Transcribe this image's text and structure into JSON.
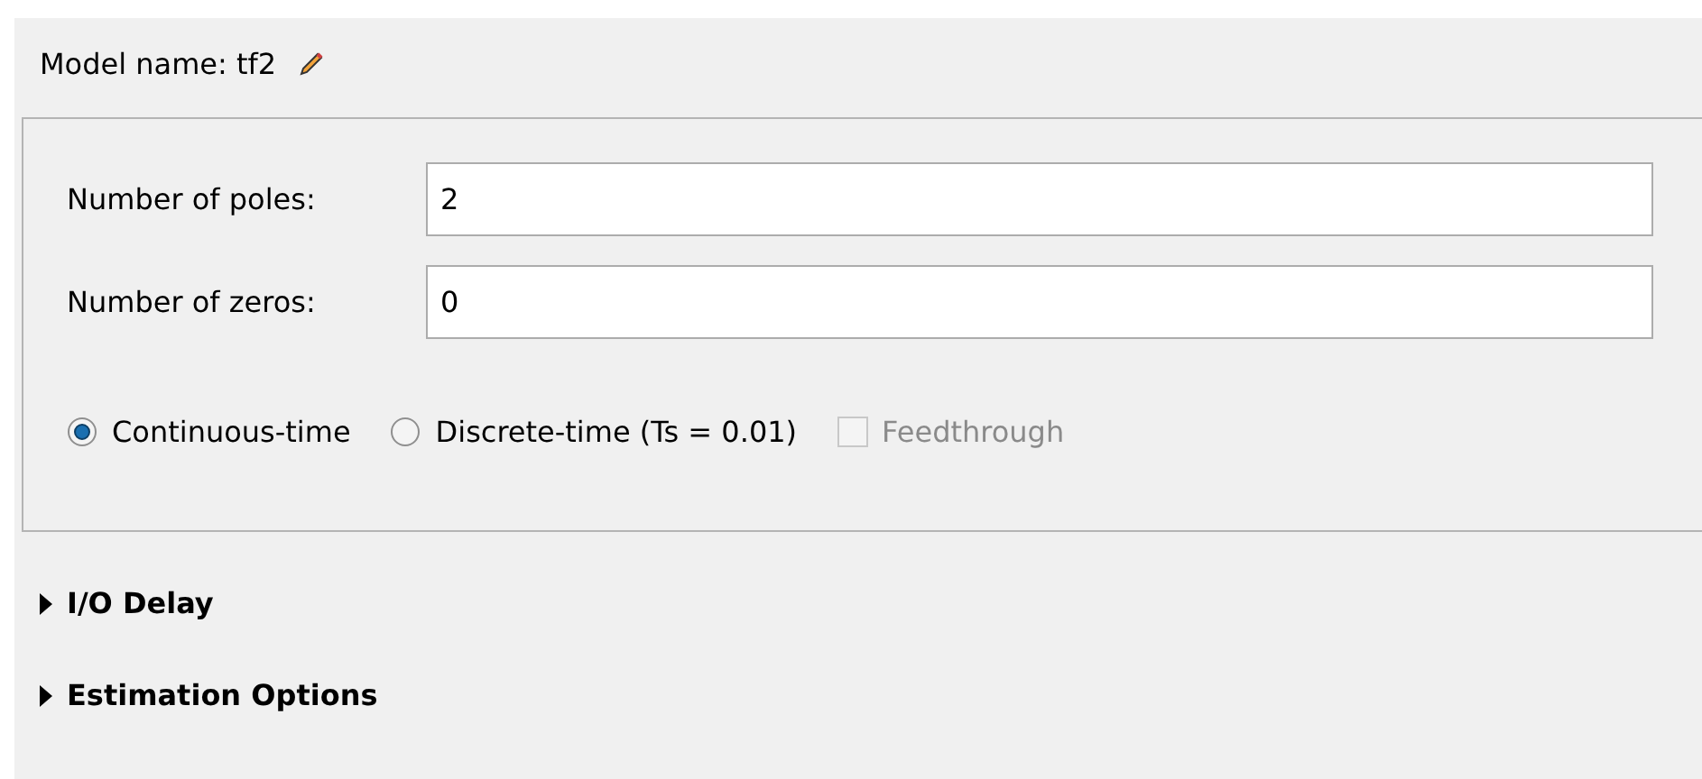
{
  "model_name": {
    "label": "Model name: tf2"
  },
  "fields": [
    {
      "label": "Number of poles:",
      "value": "2"
    },
    {
      "label": "Number of zeros:",
      "value": "0"
    }
  ],
  "time_options": [
    {
      "kind": "radio",
      "label": "Continuous-time",
      "selected": true,
      "disabled": false
    },
    {
      "kind": "radio",
      "label": "Discrete-time (Ts = 0.01)",
      "selected": false,
      "disabled": false
    },
    {
      "kind": "checkbox",
      "label": "Feedthrough",
      "checked": false,
      "disabled": true
    }
  ],
  "sections": [
    {
      "label": "I/O Delay",
      "expanded": false
    },
    {
      "label": "Estimation Options",
      "expanded": false
    }
  ]
}
